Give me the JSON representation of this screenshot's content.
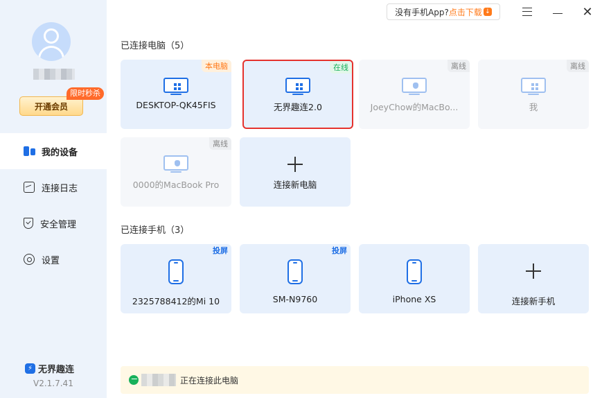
{
  "sidebar": {
    "vip_button": "开通会员",
    "promo_badge": "限时秒杀",
    "nav": [
      {
        "label": "我的设备",
        "icon": "devices-icon",
        "active": true
      },
      {
        "label": "连接日志",
        "icon": "log-icon"
      },
      {
        "label": "安全管理",
        "icon": "shield-icon"
      },
      {
        "label": "设置",
        "icon": "gear-icon"
      }
    ],
    "brand": "无界趣连",
    "version": "V2.1.7.41"
  },
  "topbar": {
    "no_phone_app": "没有手机App?",
    "download": "点击下载"
  },
  "computers": {
    "title": "已连接电脑（5）",
    "items": [
      {
        "name": "DESKTOP-QK45FIS",
        "tag": "本电脑",
        "status": "local",
        "os": "windows"
      },
      {
        "name": "无界趣连2.0",
        "tag": "在线",
        "status": "online",
        "os": "windows"
      },
      {
        "name": "JoeyChow的MacBo...",
        "tag": "离线",
        "status": "offline",
        "os": "mac"
      },
      {
        "name": "我",
        "tag": "离线",
        "status": "offline",
        "os": "windows"
      },
      {
        "name": "0000的MacBook Pro",
        "tag": "离线",
        "status": "offline",
        "os": "mac"
      }
    ],
    "add_label": "连接新电脑"
  },
  "phones": {
    "title": "已连接手机（3）",
    "items": [
      {
        "name": "2325788412的Mi 10",
        "tag": "投屏"
      },
      {
        "name": "SM-N9760",
        "tag": "投屏"
      },
      {
        "name": "iPhone XS",
        "tag": ""
      }
    ],
    "add_label": "连接新手机"
  },
  "status": {
    "text": "正在连接此电脑"
  },
  "colors": {
    "accent": "#1f6fe5",
    "online": "#18b15b",
    "local": "#ff7a1a",
    "selected_border": "#e5322d"
  }
}
